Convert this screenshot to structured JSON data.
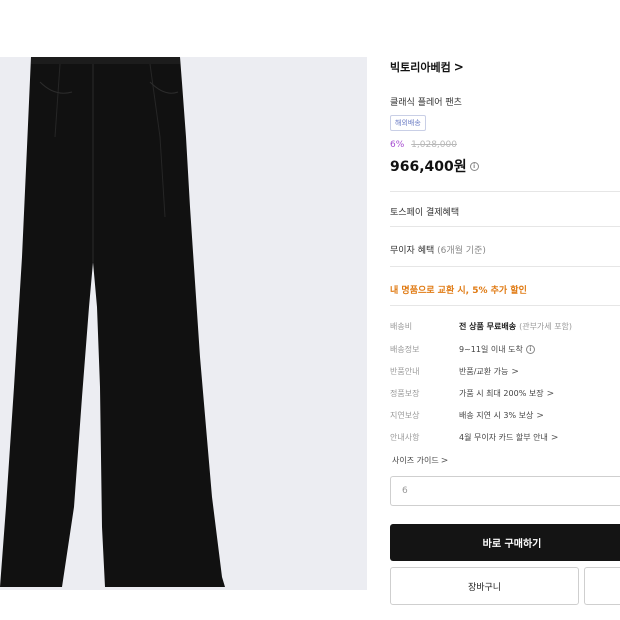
{
  "product_image": {
    "icon": "black-flare-pants"
  },
  "brand": {
    "name": "빅토리아베컴",
    "chevron": ">"
  },
  "product": {
    "name": "클래식 플레어 팬츠",
    "badge": "해외배송",
    "discount_percent": "6%",
    "original_price": "1,028,000",
    "price": "966,400원",
    "price_info_icon": "i"
  },
  "benefits": {
    "toss": "토스페이 결제혜택",
    "installment_label": "무이자 혜택",
    "installment_sub": "(6개월 기준)",
    "trade_in": "내 명품으로 교환 시, 5% 추가 할인"
  },
  "details": [
    {
      "label": "배송비",
      "value_bold": "전 상품 무료배송",
      "value_muted": "(관부가세 포함)",
      "chevron": ""
    },
    {
      "label": "배송정보",
      "value": "9~11일 이내 도착",
      "info": "i",
      "chevron": ""
    },
    {
      "label": "반품안내",
      "value": "반품/교환 가능",
      "chevron": ">"
    },
    {
      "label": "정품보장",
      "value": "가품 시 최대 200% 보장",
      "chevron": ">"
    },
    {
      "label": "지연보상",
      "value": "배송 지연 시 3% 보상",
      "chevron": ">"
    },
    {
      "label": "안내사항",
      "value": "4월 무이자 카드 할부 안내",
      "chevron": ">"
    }
  ],
  "size": {
    "guide_label": "사이즈 가이드",
    "chevron": ">",
    "selected": "6"
  },
  "actions": {
    "buy_now": "바로 구매하기",
    "cart": "장바구니"
  }
}
